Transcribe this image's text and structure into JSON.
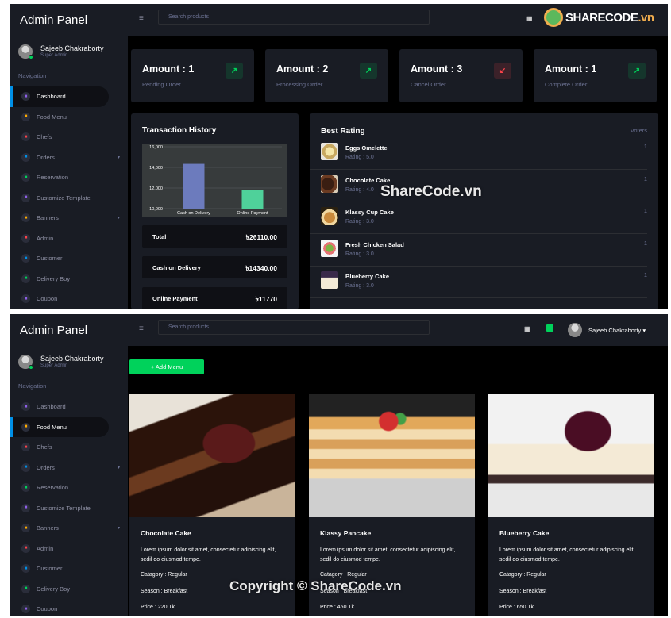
{
  "app": {
    "brand": "Admin Panel"
  },
  "profile": {
    "name": "Sajeeb Chakraborty",
    "role": "Super Admin"
  },
  "nav": {
    "label": "Navigation",
    "items": [
      {
        "label": "Dashboard",
        "icon": "speedometer-icon",
        "color": "#8f5fe8",
        "chevron": false
      },
      {
        "label": "Food Menu",
        "icon": "food-icon",
        "color": "#ffab00",
        "chevron": false
      },
      {
        "label": "Chefs",
        "icon": "chef-icon",
        "color": "#fc424a",
        "chevron": false
      },
      {
        "label": "Orders",
        "icon": "orders-icon",
        "color": "#0090e7",
        "chevron": true
      },
      {
        "label": "Reservation",
        "icon": "chart-icon",
        "color": "#00d25b",
        "chevron": false
      },
      {
        "label": "Customize Template",
        "icon": "palette-icon",
        "color": "#8f5fe8",
        "chevron": false
      },
      {
        "label": "Banners",
        "icon": "banner-icon",
        "color": "#ffab00",
        "chevron": true
      },
      {
        "label": "Admin",
        "icon": "admin-icon",
        "color": "#fc424a",
        "chevron": false
      },
      {
        "label": "Customer",
        "icon": "customer-icon",
        "color": "#0090e7",
        "chevron": false
      },
      {
        "label": "Delivery Boy",
        "icon": "delivery-icon",
        "color": "#00d25b",
        "chevron": false
      },
      {
        "label": "Coupon",
        "icon": "coupon-icon",
        "color": "#8f5fe8",
        "chevron": false
      }
    ]
  },
  "search": {
    "placeholder": "Search products"
  },
  "watermarks": {
    "logo_main": "SHARECODE",
    "logo_tld": ".vn",
    "center": "ShareCode.vn",
    "bottom": "Copyright © ShareCode.vn"
  },
  "dashboard": {
    "active_nav": "Dashboard",
    "stats": [
      {
        "title": "Amount : 1",
        "subtitle": "Pending Order",
        "trend": "up",
        "glyph": "↗"
      },
      {
        "title": "Amount : 2",
        "subtitle": "Processing Order",
        "trend": "up",
        "glyph": "↗"
      },
      {
        "title": "Amount : 3",
        "subtitle": "Cancel Order",
        "trend": "down",
        "glyph": "↙"
      },
      {
        "title": "Amount : 1",
        "subtitle": "Complete Order",
        "trend": "up",
        "glyph": "↗"
      }
    ],
    "transaction": {
      "title": "Transaction History",
      "rows": [
        {
          "label": "Total",
          "value": "৳26110.00"
        },
        {
          "label": "Cash on Delivery",
          "value": "৳14340.00"
        },
        {
          "label": "Online Payment",
          "value": "৳11770"
        }
      ]
    },
    "best_rating": {
      "title": "Best Rating",
      "voters_label": "Voters",
      "items": [
        {
          "name": "Eggs Omelette",
          "rating": "Rating : 5.0",
          "voters": "1"
        },
        {
          "name": "Chocolate Cake",
          "rating": "Rating : 4.0",
          "voters": "1"
        },
        {
          "name": "Klassy Cup Cake",
          "rating": "Rating : 3.0",
          "voters": "1"
        },
        {
          "name": "Fresh Chicken Salad",
          "rating": "Rating : 3.0",
          "voters": "1"
        },
        {
          "name": "Blueberry Cake",
          "rating": "Rating : 3.0",
          "voters": "1"
        }
      ]
    }
  },
  "chart_data": {
    "type": "bar",
    "categories": [
      "Cash on Delivery",
      "Online Payment"
    ],
    "values": [
      14340,
      11770
    ],
    "colors": [
      "#6c7bbd",
      "#4fd19a"
    ],
    "yticks": [
      "10,000",
      "12,000",
      "14,000",
      "16,000"
    ],
    "ylim": [
      10000,
      16000
    ],
    "grid": true
  },
  "menu_page": {
    "active_nav": "Food Menu",
    "add_button": "+ Add Menu",
    "items": [
      {
        "name": "Chocolate Cake",
        "desc": "Lorem ipsum dolor sit amet, consectetur adipiscing elit, sedil do eiusmod tempe.",
        "category": "Catagory : Regular",
        "season": "Season : Breakfast",
        "price": "Price : 220 Tk"
      },
      {
        "name": "Klassy Pancake",
        "desc": "Lorem ipsum dolor sit amet, consectetur adipiscing elit, sedil do eiusmod tempe.",
        "category": "Catagory : Regular",
        "season": "Season : Breakfast",
        "price": "Price : 450 Tk"
      },
      {
        "name": "Blueberry Cake",
        "desc": "Lorem ipsum dolor sit amet, consectetur adipiscing elit, sedil do eiusmod tempe.",
        "category": "Catagory : Regular",
        "season": "Season : Breakfast",
        "price": "Price : 650 Tk"
      }
    ]
  }
}
